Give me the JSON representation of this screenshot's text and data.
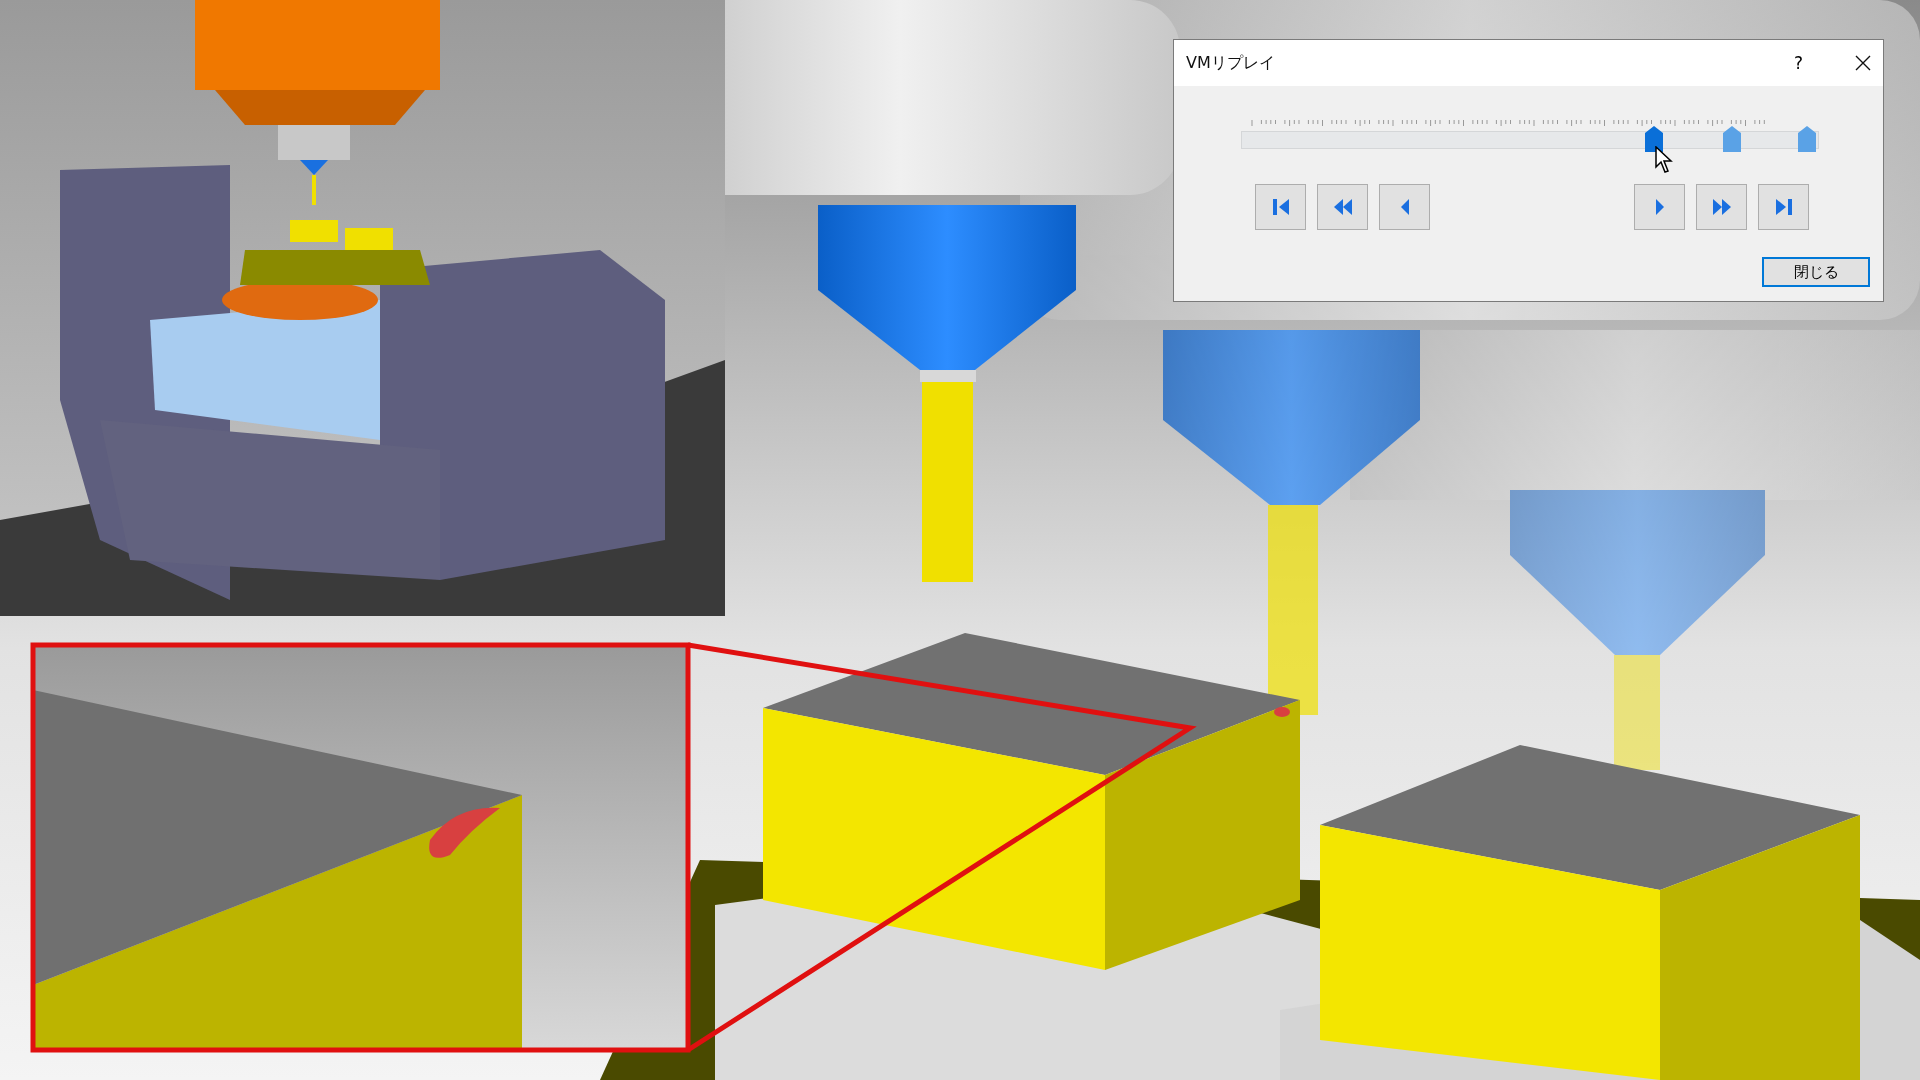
{
  "dialog": {
    "title": "VMリプレイ",
    "help": "?",
    "timeline": {
      "markers": [
        {
          "level": 0.714,
          "selected": true
        },
        {
          "level": 0.85,
          "selected": false
        },
        {
          "level": 0.98,
          "selected": false
        }
      ]
    },
    "buttons": [
      {
        "kind": "first"
      },
      {
        "kind": "rewind"
      },
      {
        "kind": "back"
      },
      {
        "kind": "play"
      },
      {
        "kind": "forward"
      },
      {
        "kind": "last"
      }
    ],
    "close_button": "閉じる"
  }
}
